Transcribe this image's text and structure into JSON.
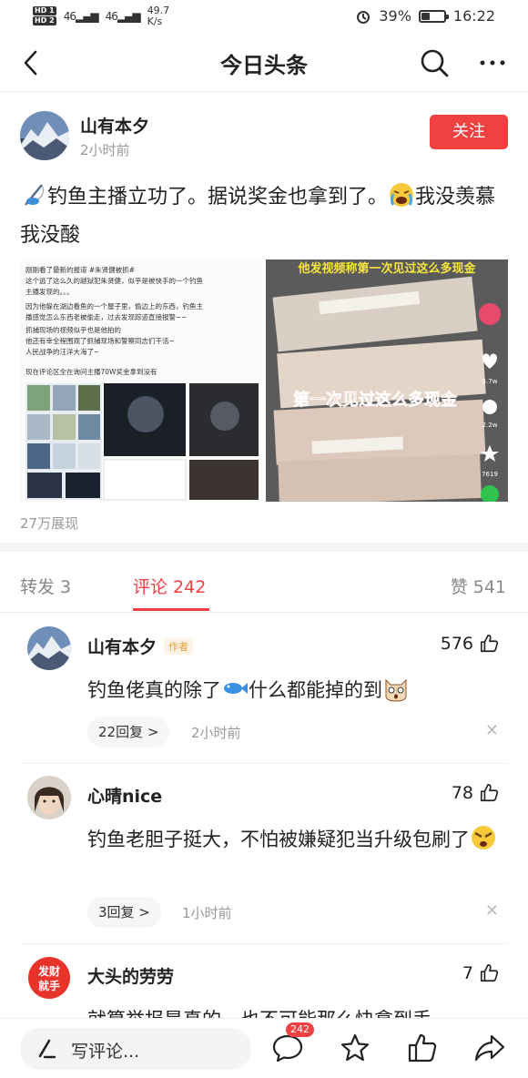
{
  "status": {
    "hd1": "HD 1",
    "hd2": "HD 2",
    "net1": "46",
    "net2": "46",
    "speed_value": "49.7",
    "speed_unit": "K/s",
    "battery": "39%",
    "battery_level": 0.39,
    "time": "16:22"
  },
  "nav": {
    "title": "今日头条"
  },
  "author": {
    "name": "山有本夕",
    "time": "2小时前",
    "follow_label": "关注"
  },
  "post": {
    "text_part1": "钓鱼主播立功了。据说奖金也拿到了。",
    "text_part2": "我没羡慕我没酸",
    "left_image": {
      "line1": "刚刚看了最新的报道 #朱贤健被抓#",
      "line2": "这个逃了这么久的越狱犯朱贤健，似乎是被快手的一个钓鱼",
      "line3": "主播发现的。。。",
      "line4": "因为他躲在湖边看鱼的一个屋子里，偷边上的东西，钓鱼主",
      "line5": "播感觉怎么东西老被偷走，过去发现踪迹直接报警~~",
      "line6": "抓捕现场的视频似乎也是他拍的",
      "line7": "他还有幸全程围观了抓捕现场和警察同志们干活~",
      "line8": "人民战争的汪洋大海了~",
      "line9": "现在评论区全在询问主播70W奖金拿到没有"
    },
    "right_image": {
      "banner": "他发视频称第一次见过这么多现金",
      "caption": "第一次见过这么多现金",
      "likes": "5.7w",
      "comments": "2.2w",
      "stars": "7619"
    },
    "views": "27万展现"
  },
  "tabs": {
    "forward": "转发 3",
    "comment": "评论 242",
    "like": "赞 541"
  },
  "comments": [
    {
      "name": "山有本夕",
      "tag": "作者",
      "likes": "576",
      "text_part1": "钓鱼佬真的除了",
      "text_part2": "什么都能掉的到",
      "reply": "22回复 >",
      "time": "2小时前"
    },
    {
      "name": "心晴nice",
      "likes": "78",
      "text_part1": "钓鱼老胆子挺大，不怕被嫌疑犯当升级包刷了",
      "reply": "3回复 >",
      "time": "1小时前"
    },
    {
      "name": "大头的劳劳",
      "likes": "7",
      "avatar_text1": "发财",
      "avatar_text2": "就手",
      "text_part1": "就算举报是真的，也不可能那么快拿到手"
    }
  ],
  "bottom": {
    "write_placeholder": "写评论...",
    "comment_badge": "242"
  },
  "colors": {
    "accent": "#f04142",
    "author_tag": "#e8a13a"
  }
}
